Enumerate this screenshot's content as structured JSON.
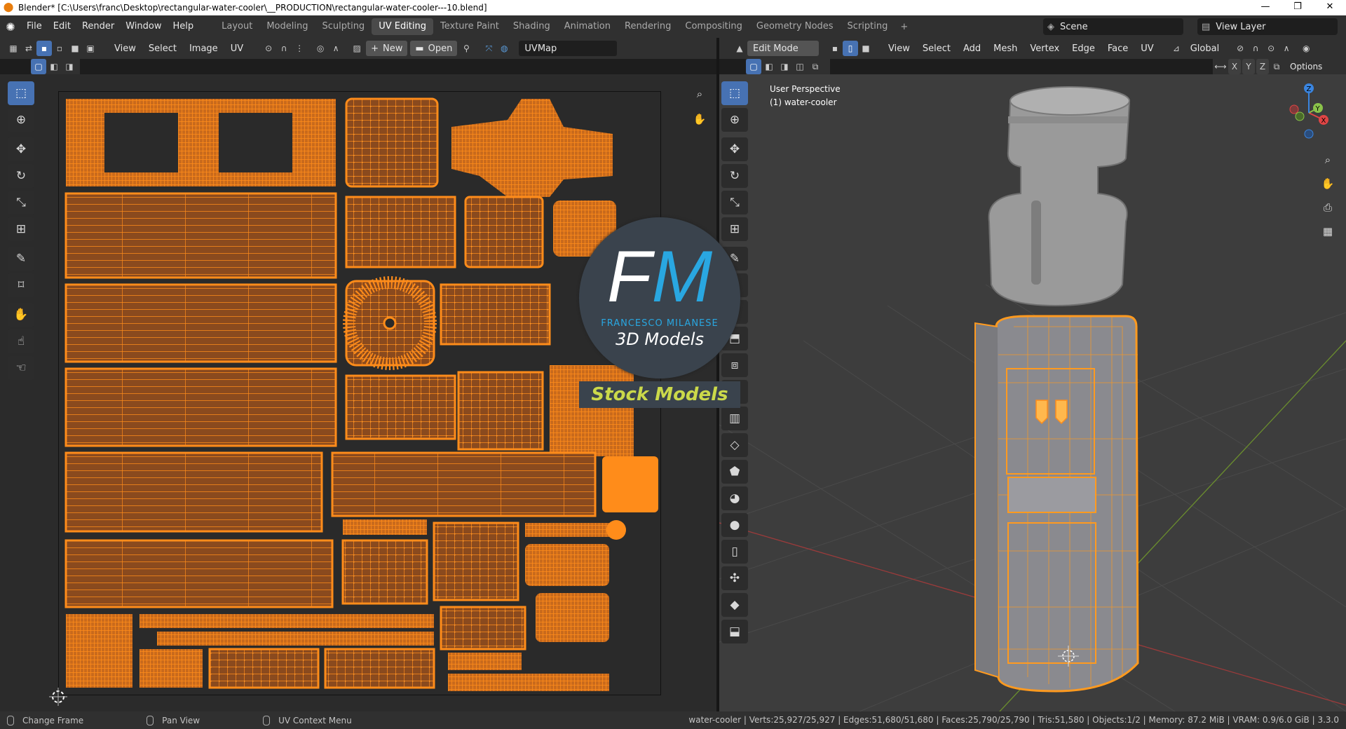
{
  "titlebar": {
    "title": "Blender* [C:\\Users\\franc\\Desktop\\rectangular-water-cooler\\__PRODUCTION\\rectangular-water-cooler---10.blend]",
    "minimize": "—",
    "maximize": "❐",
    "close": "✕"
  },
  "menu": [
    "File",
    "Edit",
    "Render",
    "Window",
    "Help"
  ],
  "workspaces": [
    "Layout",
    "Modeling",
    "Sculpting",
    "UV Editing",
    "Texture Paint",
    "Shading",
    "Animation",
    "Rendering",
    "Compositing",
    "Geometry Nodes",
    "Scripting"
  ],
  "active_workspace": "UV Editing",
  "scene": {
    "label": "Scene",
    "view_layer": "View Layer"
  },
  "uv_header": {
    "menus": [
      "View",
      "Select",
      "Image",
      "UV"
    ],
    "new_label": "New",
    "open_label": "Open",
    "uvmap": "UVMap"
  },
  "vp_header": {
    "mode": "Edit Mode",
    "menus": [
      "View",
      "Select",
      "Add",
      "Mesh",
      "Vertex",
      "Edge",
      "Face",
      "UV"
    ],
    "orientation": "Global",
    "options": "Options",
    "axes": [
      "X",
      "Y",
      "Z"
    ]
  },
  "viewport": {
    "perspective": "User Perspective",
    "object": "(1) water-cooler"
  },
  "gizmo": {
    "x": "X",
    "y": "Y",
    "z": "Z"
  },
  "watermark": {
    "f": "F",
    "m": "M",
    "name": "FRANCESCO MILANESE",
    "models": "3D Models",
    "stock": "Stock Models"
  },
  "status": {
    "hint1": "Change Frame",
    "hint2": "Pan View",
    "hint3": "UV Context Menu",
    "stats": "water-cooler | Verts:25,927/25,927 | Edges:51,680/51,680 | Faces:25,790/25,790 | Tris:51,580 | Objects:1/2 | Memory: 87.2 MiB | VRAM: 0.9/6.0 GiB | 3.3.0"
  },
  "colors": {
    "accent": "#4772b3",
    "uv": "#ff8c1a",
    "uvfill": "#8a4a1e",
    "wire": "#ff9a1f"
  }
}
